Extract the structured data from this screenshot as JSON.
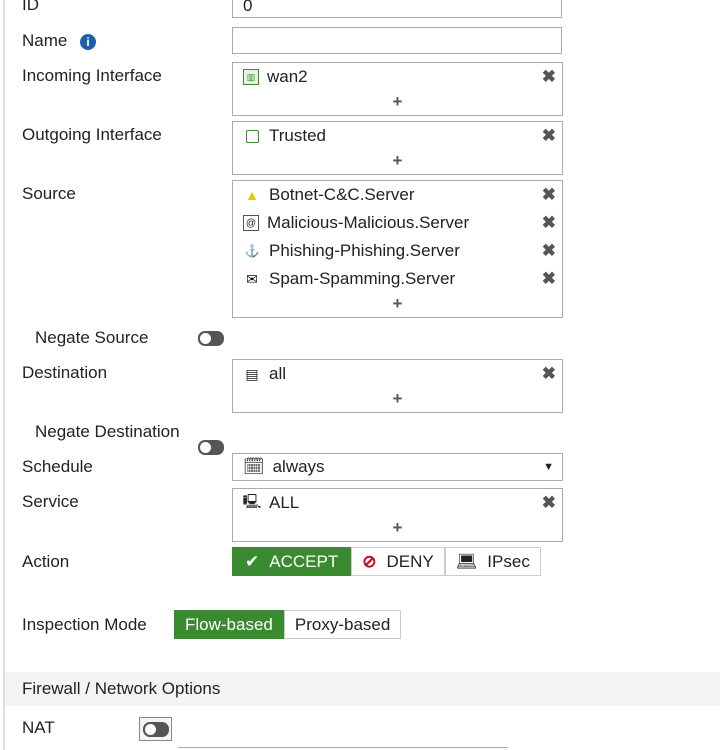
{
  "fields": {
    "id": {
      "label": "ID",
      "value": "0"
    },
    "name": {
      "label": "Name",
      "value": ""
    },
    "incoming": {
      "label": "Incoming Interface",
      "items": [
        "wan2"
      ]
    },
    "outgoing": {
      "label": "Outgoing Interface",
      "items": [
        "Trusted"
      ]
    },
    "source": {
      "label": "Source",
      "items": [
        "Botnet-C&C.Server",
        "Malicious-Malicious.Server",
        "Phishing-Phishing.Server",
        "Spam-Spamming.Server"
      ]
    },
    "negate_source": {
      "label": "Negate Source"
    },
    "destination": {
      "label": "Destination",
      "items": [
        "all"
      ]
    },
    "negate_destination": {
      "label": "Negate Destination"
    },
    "schedule": {
      "label": "Schedule",
      "value": "always"
    },
    "service": {
      "label": "Service",
      "items": [
        "ALL"
      ]
    },
    "action": {
      "label": "Action",
      "options": [
        "ACCEPT",
        "DENY",
        "IPsec"
      ],
      "selected": "ACCEPT"
    },
    "inspection": {
      "label": "Inspection Mode",
      "options": [
        "Flow-based",
        "Proxy-based"
      ],
      "selected": "Flow-based"
    }
  },
  "section": {
    "title": "Firewall / Network Options"
  },
  "nat": {
    "label": "NAT"
  },
  "symbols": {
    "remove": "✖",
    "add": "+",
    "check": "✔",
    "deny": "⊘",
    "caret": "▼",
    "info": "i"
  },
  "colors": {
    "accent": "#3a8a2f",
    "deny": "#d0021b",
    "info": "#1f5fa8"
  }
}
